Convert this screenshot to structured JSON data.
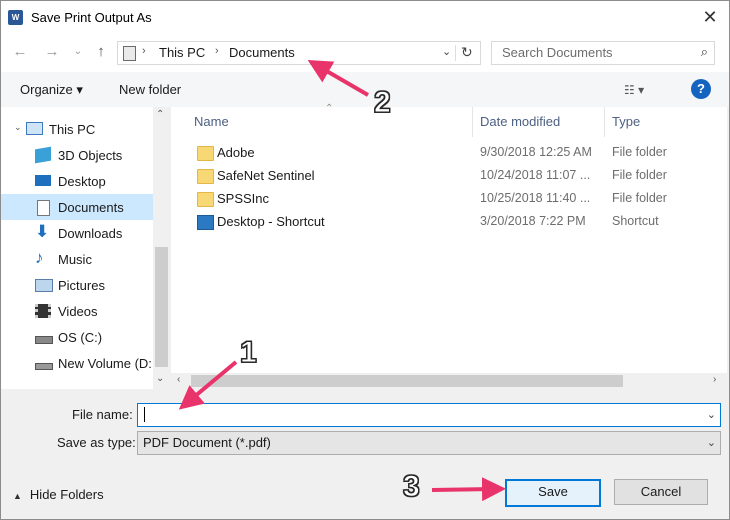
{
  "window": {
    "title": "Save Print Output As"
  },
  "address": {
    "crumbs": [
      "This PC",
      "Documents"
    ]
  },
  "search": {
    "placeholder": "Search Documents"
  },
  "toolbar": {
    "organize": "Organize ▾",
    "new_folder": "New folder"
  },
  "nav": {
    "items": [
      {
        "label": "This PC",
        "icon": "computer-icon"
      },
      {
        "label": "3D Objects",
        "icon": "cube-icon"
      },
      {
        "label": "Desktop",
        "icon": "desktop-icon"
      },
      {
        "label": "Documents",
        "icon": "document-icon",
        "selected": true
      },
      {
        "label": "Downloads",
        "icon": "download-arrow-icon"
      },
      {
        "label": "Music",
        "icon": "music-note-icon"
      },
      {
        "label": "Pictures",
        "icon": "picture-icon"
      },
      {
        "label": "Videos",
        "icon": "film-icon"
      },
      {
        "label": "OS (C:)",
        "icon": "drive-icon"
      },
      {
        "label": "New Volume (D:",
        "icon": "drive-icon"
      }
    ]
  },
  "files": {
    "columns": [
      "Name",
      "Date modified",
      "Type"
    ],
    "rows": [
      {
        "name": "Adobe",
        "date": "9/30/2018 12:25 AM",
        "type": "File folder",
        "icon": "folder-icon"
      },
      {
        "name": "SafeNet Sentinel",
        "date": "10/24/2018 11:07 ...",
        "type": "File folder",
        "icon": "folder-icon"
      },
      {
        "name": "SPSSInc",
        "date": "10/25/2018 11:40 ...",
        "type": "File folder",
        "icon": "folder-icon"
      },
      {
        "name": "Desktop - Shortcut",
        "date": "3/20/2018 7:22 PM",
        "type": "Shortcut",
        "icon": "shortcut-icon"
      }
    ]
  },
  "form": {
    "file_name_label": "File name:",
    "file_name_value": "",
    "save_type_label": "Save as type:",
    "save_type_value": "PDF Document (*.pdf)"
  },
  "footer": {
    "hide_folders": "Hide Folders",
    "save": "Save",
    "cancel": "Cancel"
  },
  "annotations": [
    "1",
    "2",
    "3"
  ],
  "colors": {
    "accent": "#0078d7",
    "arrow": "#e8336b",
    "selection": "#cce8ff"
  }
}
